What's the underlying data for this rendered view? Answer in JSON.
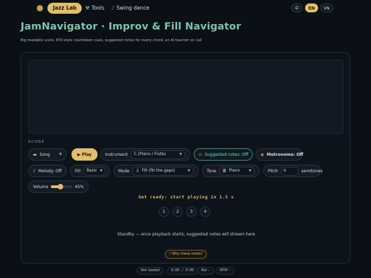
{
  "nav": {
    "brand": "Jazz Lab",
    "tools": "Tools",
    "swing": "Swing dance",
    "langs": [
      "中",
      "EN",
      "VN"
    ],
    "active_lang": "EN"
  },
  "header": {
    "title": "JamNavigator · Improv & Fill Navigator",
    "subtitle": "Big readable score, KTV-style countdown cues, suggested notes for every chord, an AI teacher on call"
  },
  "score": {
    "label": "SCORE"
  },
  "controls": {
    "source": "Song",
    "play": "▶ Play",
    "instrument_label": "Instrument",
    "instrument_value": "C (Piano / Flute)",
    "suggested": "Suggested notes: Off",
    "metronome": "Metronome: Off",
    "melody": "Melody: Off",
    "fill_label": "Fill",
    "fill_value": "Basic",
    "mode_label": "Mode",
    "mode_value": "Fill (fill the gaps)",
    "tone_label": "Tone",
    "tone_value": "Piano",
    "pitch_label": "Pitch",
    "pitch_value": "0",
    "pitch_unit": "semitones",
    "volume_label": "Volume",
    "volume_value": "45%",
    "volume_level": 0.45
  },
  "countdown": "Get ready: start playing in 1.5 s",
  "beats": [
    "1",
    "2",
    "3",
    "4"
  ],
  "standby": "Standby — once playback starts, suggested notes will stream here",
  "why": "Why these notes?",
  "status": {
    "load": "Not loaded",
    "time": "0:00 / 0:00",
    "bar": "Bar –",
    "bpm": "BPM –"
  },
  "colors": {
    "accent": "#e2bd6b",
    "title": "#7fc4a8",
    "teal": "#7fd6cf",
    "bg": "#0b1017"
  }
}
